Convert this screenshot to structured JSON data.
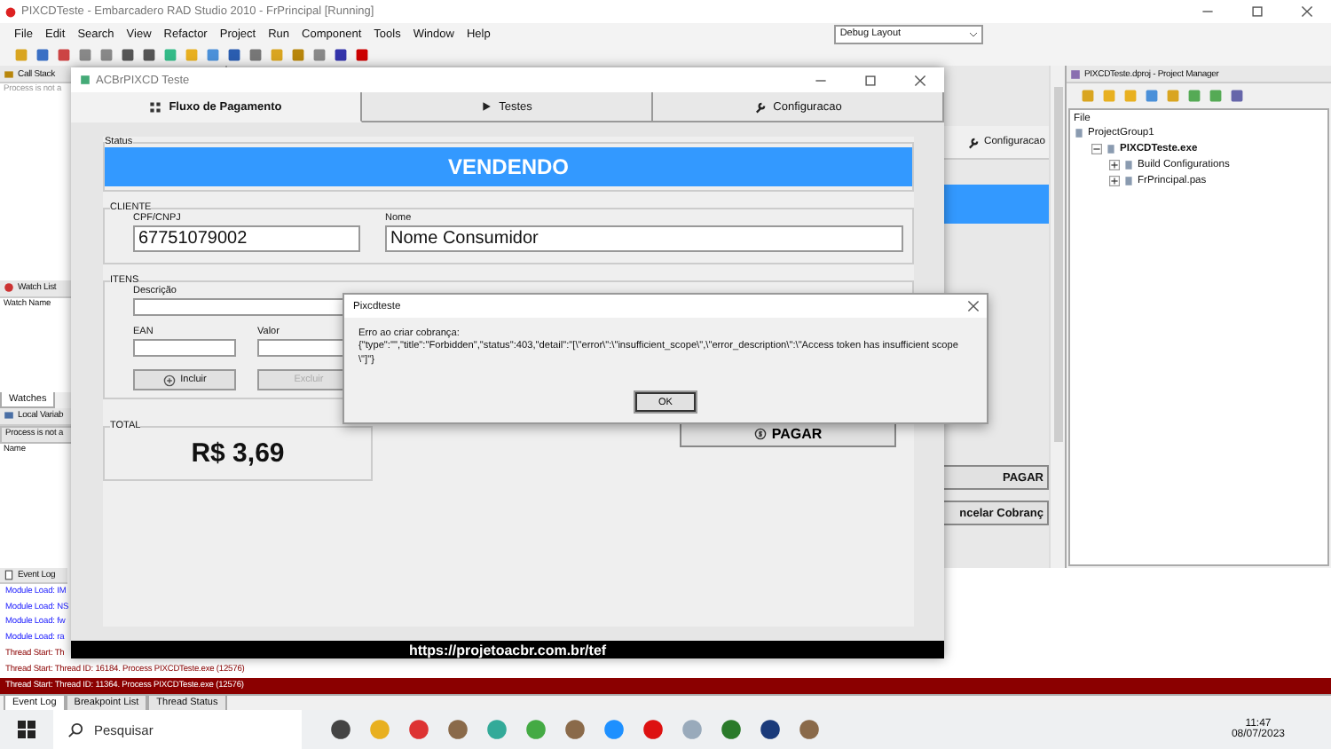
{
  "ide": {
    "title": "PIXCDTeste - Embarcadero RAD Studio 2010 - FrPrincipal [Running]",
    "menu": [
      "File",
      "Edit",
      "Search",
      "View",
      "Refactor",
      "Project",
      "Run",
      "Component",
      "Tools",
      "Window",
      "Help"
    ],
    "layout_combo": "Debug Layout"
  },
  "left_panels": {
    "call_stack": {
      "title": "Call Stack",
      "text": "Process is not a"
    },
    "watch_list": {
      "title": "Watch List",
      "column": "Watch Name",
      "tabs": [
        {
          "label": "Watches",
          "selected": true
        }
      ]
    },
    "local_variables": {
      "title": "Local Variab",
      "status": "Process is not a",
      "column": "Name"
    }
  },
  "designer": {
    "tab": "Configuracao",
    "buttons": [
      "PAGAR",
      "ncelar Cobranç"
    ]
  },
  "project_manager": {
    "title": "PIXCDTeste.dproj - Project Manager",
    "column": "File",
    "tree": [
      {
        "label": "ProjectGroup1",
        "children": [
          {
            "label": "PIXCDTeste.exe",
            "expanded": true,
            "children": [
              {
                "label": "Build Configurations",
                "expanded": false
              },
              {
                "label": "FrPrincipal.pas",
                "expanded": false
              }
            ]
          }
        ]
      }
    ]
  },
  "event_log": {
    "title": "Event Log",
    "lines": [
      {
        "text": "Module Load: IM",
        "kind": "module",
        "selected": false
      },
      {
        "text": "Module Load: NS",
        "kind": "module",
        "selected": false
      },
      {
        "text": "Module Load: fw",
        "kind": "module",
        "selected": false
      },
      {
        "text": "Module Load: ra",
        "kind": "module",
        "selected": false
      },
      {
        "text": "Thread Start: Th",
        "kind": "thread",
        "selected": false
      },
      {
        "text": "Thread Start: Thread ID: 16184. Process PIXCDTeste.exe (12576)",
        "kind": "thread",
        "selected": false
      },
      {
        "text": "Thread Start: Thread ID: 11364. Process PIXCDTeste.exe (12576)",
        "kind": "thread",
        "selected": true
      }
    ]
  },
  "bottom_tabs": [
    {
      "label": "Event Log",
      "selected": true
    },
    {
      "label": "Breakpoint List",
      "selected": false
    },
    {
      "label": "Thread Status",
      "selected": false
    }
  ],
  "app_window": {
    "title": "ACBrPIXCD Teste",
    "tabs": [
      {
        "label": "Fluxo de Pagamento",
        "selected": true
      },
      {
        "label": "Testes",
        "selected": false
      },
      {
        "label": "Configuracao",
        "selected": false
      }
    ],
    "status": {
      "legend": "Status",
      "banner": "VENDENDO"
    },
    "cliente": {
      "legend": "CLIENTE",
      "fields": [
        {
          "label": "CPF/CNPJ",
          "value": "67751079002"
        },
        {
          "label": "Nome",
          "value": "Nome Consumidor"
        }
      ]
    },
    "itens": {
      "legend": "ITENS",
      "description_label": "Descrição",
      "ean_label": "EAN",
      "valor_label": "Valor",
      "buttons": [
        {
          "label": "Incluir",
          "disabled": false
        },
        {
          "label": "Excluir",
          "disabled": true
        }
      ]
    },
    "total": {
      "legend": "TOTAL",
      "value": "R$ 3,69"
    },
    "pay_button": "PAGAR",
    "footer": "https://projetoacbr.com.br/tef"
  },
  "dialog": {
    "title": "Pixcdteste",
    "message": "Erro ao criar cobrança:",
    "detail": "{\"type\":\"\",\"title\":\"Forbidden\",\"status\":403,\"detail\":\"[\\\"error\\\":\\\"insufficient_scope\\\",\\\"error_description\\\":\\\"Access token has insufficient scope\\\"]\"}",
    "button": "OK"
  },
  "taskbar": {
    "search_placeholder": "Pesquisar",
    "time": "11:47",
    "date": "08/07/2023"
  }
}
